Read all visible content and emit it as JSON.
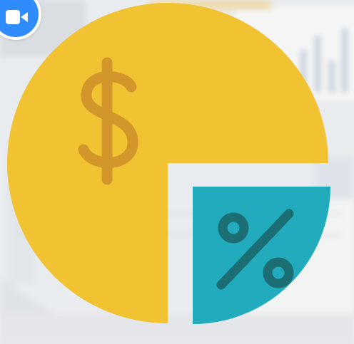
{
  "graphic": {
    "currency_icon": "dollar-sign-icon",
    "percent_icon": "percent-sign-icon",
    "share_percent": 25
  },
  "badge": {
    "icon": "video-camera-icon"
  },
  "colors": {
    "pie_main": "#f1c232",
    "dollar": "#d3962a",
    "pie_slice": "#21abbd",
    "percent": "#1b6f74",
    "badge": "#2f8cff",
    "background": "#eef0f2"
  }
}
